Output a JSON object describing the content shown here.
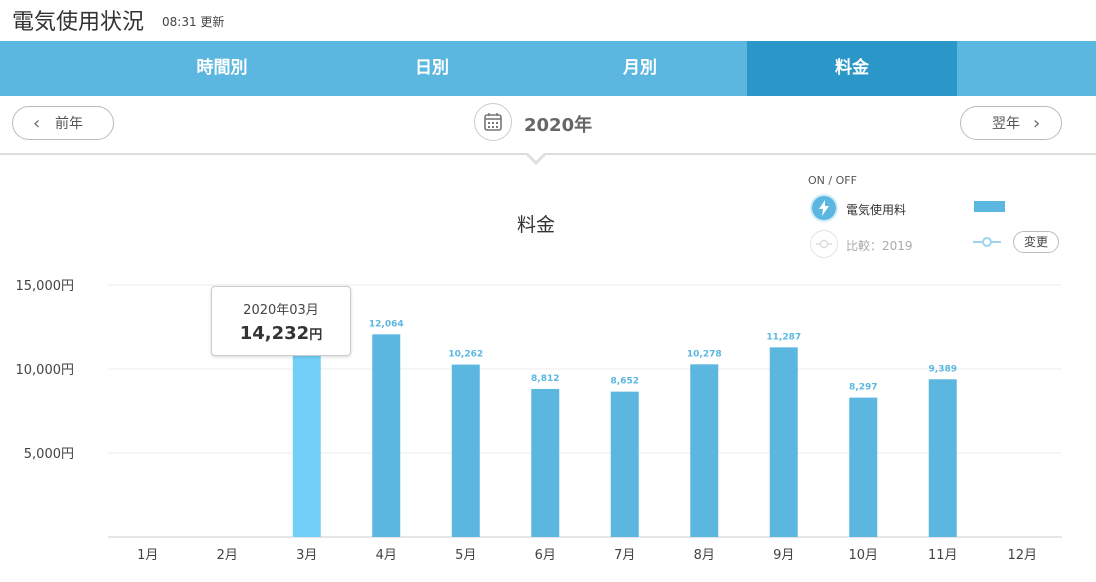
{
  "header": {
    "title": "電気使用状況",
    "time": "08:31",
    "updated_label": "更新"
  },
  "tabs": [
    {
      "label": "時間別",
      "active": false
    },
    {
      "label": "日別",
      "active": false
    },
    {
      "label": "月別",
      "active": false
    },
    {
      "label": "料金",
      "active": true
    }
  ],
  "nav": {
    "prev_label": "前年",
    "next_label": "翌年",
    "year": "2020年",
    "prev_icon": "chevron-left-icon",
    "next_icon": "chevron-right-icon",
    "calendar_icon": "calendar-icon"
  },
  "legend": {
    "onoff_label": "ON / OFF",
    "series_label": "電気使用料",
    "compare_label": "比較：2019",
    "change_label": "変更",
    "series_icon": "lightning-icon",
    "compare_icon": "compare-line-icon"
  },
  "tooltip": {
    "date": "2020年03月",
    "value": "14,232",
    "unit": "円"
  },
  "colors": {
    "bar": "#5bb7e0",
    "bar_highlight": "#72cff7",
    "tab_bg": "#5bb7e0",
    "tab_active": "#2b97c8",
    "data_label": "#5bb7e0"
  },
  "chart_data": {
    "type": "bar",
    "title": "料金",
    "categories": [
      "1月",
      "2月",
      "3月",
      "4月",
      "5月",
      "6月",
      "7月",
      "8月",
      "9月",
      "10月",
      "11月",
      "12月"
    ],
    "series": [
      {
        "name": "電気使用料",
        "values": [
          null,
          null,
          14232,
          12064,
          10262,
          8812,
          8652,
          10278,
          11287,
          8297,
          9389,
          null
        ]
      }
    ],
    "data_labels": [
      "",
      "",
      "",
      "12,064",
      "10,262",
      "8,812",
      "8,652",
      "10,278",
      "11,287",
      "8,297",
      "9,389",
      ""
    ],
    "highlight_index": 2,
    "yticks": [
      5000,
      10000,
      15000
    ],
    "ytick_labels": [
      "5,000円",
      "10,000円",
      "15,000円"
    ],
    "ylim": [
      0,
      15000
    ],
    "grid": true
  }
}
